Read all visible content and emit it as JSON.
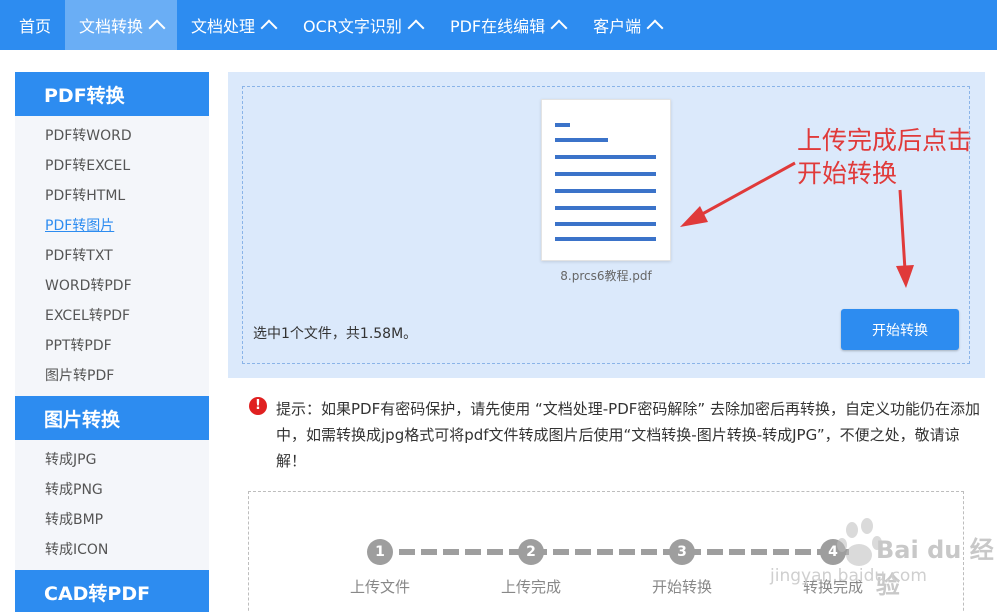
{
  "nav": {
    "items": [
      {
        "label": "首页",
        "chevron": false,
        "active": false
      },
      {
        "label": "文档转换",
        "chevron": true,
        "active": true
      },
      {
        "label": "文档处理",
        "chevron": true,
        "active": false
      },
      {
        "label": "OCR文字识别",
        "chevron": true,
        "active": false
      },
      {
        "label": "PDF在线编辑",
        "chevron": true,
        "active": false
      },
      {
        "label": "客户端",
        "chevron": true,
        "active": false
      }
    ]
  },
  "sidebar": {
    "sections": [
      {
        "title": "PDF转换",
        "items": [
          "PDF转WORD",
          "PDF转EXCEL",
          "PDF转HTML",
          "PDF转图片",
          "PDF转TXT",
          "WORD转PDF",
          "EXCEL转PDF",
          "PPT转PDF",
          "图片转PDF"
        ],
        "active_index": 3
      },
      {
        "title": "图片转换",
        "items": [
          "转成JPG",
          "转成PNG",
          "转成BMP",
          "转成ICON"
        ],
        "active_index": -1
      },
      {
        "title": "CAD转PDF",
        "items": [],
        "active_index": -1
      }
    ]
  },
  "upload": {
    "file_name": "8.prcs6教程.pdf",
    "selected_info": "选中1个文件，共1.58M。",
    "start_button": "开始转换"
  },
  "annotation": {
    "line1": "上传完成后点击",
    "line2": "开始转换"
  },
  "tip": {
    "icon": "!",
    "text": "提示：如果PDF有密码保护，请先使用 “文档处理-PDF密码解除” 去除加密后再转换，自定义功能仍在添加中，如需转换成jpg格式可将pdf文件转成图片后使用“文档转换-图片转换-转成JPG”，不便之处，敬请谅解！"
  },
  "steps": [
    {
      "number": "1",
      "label": "上传文件"
    },
    {
      "number": "2",
      "label": "上传完成"
    },
    {
      "number": "3",
      "label": "开始转换"
    },
    {
      "number": "4",
      "label": "转换完成"
    }
  ],
  "watermark": {
    "brand": "Bai du 经验",
    "url": "jingyan.baidu.com"
  },
  "colors": {
    "primary": "#2d8cf0",
    "nav_active": "#6aaef5",
    "annotation": "#e03a3a",
    "upload_bg": "#dbe9fb"
  }
}
